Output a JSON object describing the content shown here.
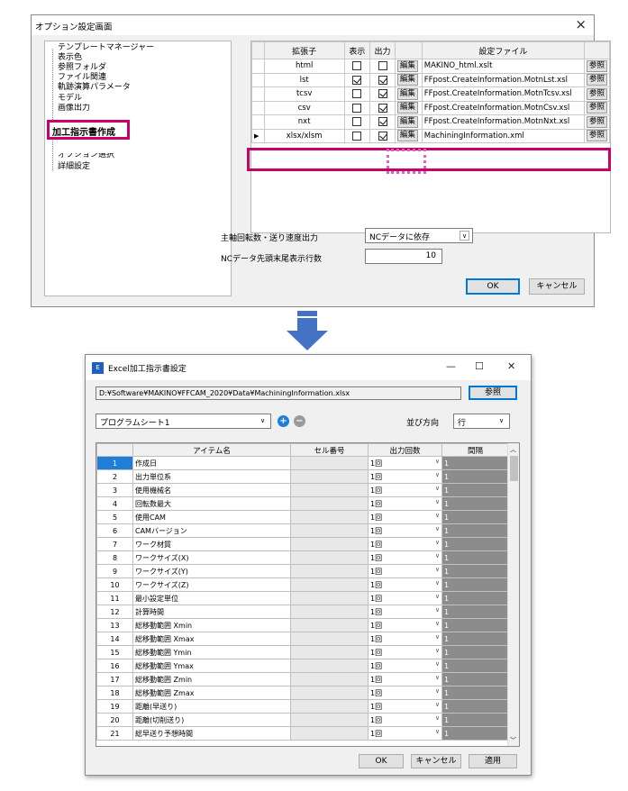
{
  "options_dialog": {
    "title": "オプション設定画面",
    "close": "×",
    "tree": [
      "テンプレートマネージャー",
      "表示色",
      "参照フォルダ",
      "ファイル関連",
      "軌跡演算パラメータ",
      "モデル",
      "画像出力",
      "加工指示書作成",
      "オプション選択",
      "詳細設定"
    ],
    "columns": [
      "拡張子",
      "表示",
      "出力",
      "",
      "設定ファイル",
      ""
    ],
    "rows": [
      {
        "ext": "html",
        "show": false,
        "out": false,
        "edit": "編集",
        "file": "MAKINO_html.xslt",
        "ref": "参照"
      },
      {
        "ext": "lst",
        "show": true,
        "out": true,
        "edit": "編集",
        "file": "FFpost.CreateInformation.MotnLst.xsl",
        "ref": "参照"
      },
      {
        "ext": "tcsv",
        "show": false,
        "out": true,
        "edit": "編集",
        "file": "FFpost.CreateInformation.MotnTcsv.xsl",
        "ref": "参照"
      },
      {
        "ext": "csv",
        "show": false,
        "out": true,
        "edit": "編集",
        "file": "FFpost.CreateInformation.MotnCsv.xsl",
        "ref": "参照"
      },
      {
        "ext": "nxt",
        "show": false,
        "out": true,
        "edit": "編集",
        "file": "FFpost.CreateInformation.MotnNxt.xsl",
        "ref": "参照"
      },
      {
        "ext": "xlsx/xlsm",
        "show": false,
        "out": true,
        "edit": "編集",
        "file": "MachiningInformation.xml",
        "ref": "参照",
        "current": true
      }
    ],
    "row_marker": "▶",
    "spindle_label": "主軸回転数・送り速度出力",
    "spindle_value": "NCデータに依存",
    "nc_lines_label": "NCデータ先頭末尾表示行数",
    "nc_lines_value": "10",
    "ok": "OK",
    "cancel": "キャンセル"
  },
  "excel_dialog": {
    "title": "Excel加工指示書設定",
    "icon_text": "E",
    "min": "—",
    "max": "☐",
    "close": "✕",
    "path": "D:¥Software¥MAKINO¥FFCAM_2020¥Data¥MachiningInformation.xlsx",
    "ref_button": "参照",
    "sheet": "プログラムシート1",
    "add_icon": "+",
    "remove_icon": "−",
    "order_label": "並び方向",
    "order_value": "行",
    "columns": [
      "",
      "アイテム名",
      "セル番号",
      "出力回数",
      "間隔"
    ],
    "items": [
      {
        "n": "1",
        "name": "作成日",
        "count": "1回",
        "interval": "1"
      },
      {
        "n": "2",
        "name": "出力単位系",
        "count": "1回",
        "interval": "1"
      },
      {
        "n": "3",
        "name": "使用機械名",
        "count": "1回",
        "interval": "1"
      },
      {
        "n": "4",
        "name": "回転数最大",
        "count": "1回",
        "interval": "1"
      },
      {
        "n": "5",
        "name": "使用CAM",
        "count": "1回",
        "interval": "1"
      },
      {
        "n": "6",
        "name": "CAMバージョン",
        "count": "1回",
        "interval": "1"
      },
      {
        "n": "7",
        "name": "ワーク材質",
        "count": "1回",
        "interval": "1"
      },
      {
        "n": "8",
        "name": "ワークサイズ(X)",
        "count": "1回",
        "interval": "1"
      },
      {
        "n": "9",
        "name": "ワークサイズ(Y)",
        "count": "1回",
        "interval": "1"
      },
      {
        "n": "10",
        "name": "ワークサイズ(Z)",
        "count": "1回",
        "interval": "1"
      },
      {
        "n": "11",
        "name": "最小設定単位",
        "count": "1回",
        "interval": "1"
      },
      {
        "n": "12",
        "name": "計算時間",
        "count": "1回",
        "interval": "1"
      },
      {
        "n": "13",
        "name": "総移動範囲 Xmin",
        "count": "1回",
        "interval": "1"
      },
      {
        "n": "14",
        "name": "総移動範囲 Xmax",
        "count": "1回",
        "interval": "1"
      },
      {
        "n": "15",
        "name": "総移動範囲 Ymin",
        "count": "1回",
        "interval": "1"
      },
      {
        "n": "16",
        "name": "総移動範囲 Ymax",
        "count": "1回",
        "interval": "1"
      },
      {
        "n": "17",
        "name": "総移動範囲 Zmin",
        "count": "1回",
        "interval": "1"
      },
      {
        "n": "18",
        "name": "総移動範囲 Zmax",
        "count": "1回",
        "interval": "1"
      },
      {
        "n": "19",
        "name": "距離(早送り)",
        "count": "1回",
        "interval": "1"
      },
      {
        "n": "20",
        "name": "距離(切削送り)",
        "count": "1回",
        "interval": "1"
      },
      {
        "n": "21",
        "name": "総早送り予想時間",
        "count": "1回",
        "interval": "1"
      }
    ],
    "ok": "OK",
    "cancel": "キャンセル",
    "apply": "適用"
  }
}
